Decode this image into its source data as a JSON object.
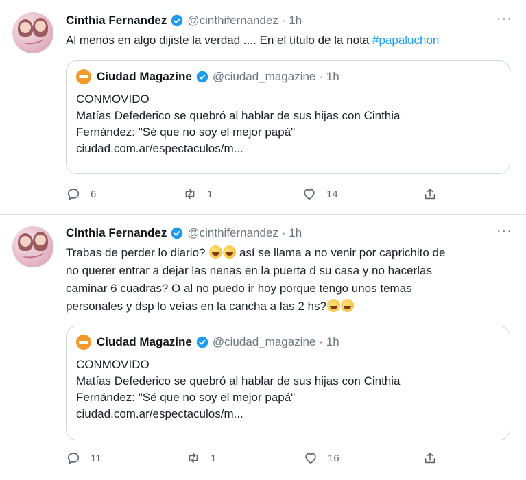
{
  "colors": {
    "link": "#1da1f2",
    "verified": "#1d9bf0",
    "muted": "#6b7780",
    "quote_logo": "#f39a2b"
  },
  "tweets": [
    {
      "author": "Cinthia Fernandez",
      "handle": "@cinthifernandez",
      "time": "· 1h",
      "more": "···",
      "text_main": "Al menos en algo dijiste la verdad .... En el título de la nota ",
      "hashtag": "#papaluchon",
      "quote": {
        "author": "Ciudad Magazine",
        "handle": "@ciudad_magazine",
        "time": "· 1h",
        "line1": "CONMOVIDO",
        "line2": "Matías Defederico se quebró al hablar de sus hijas con Cinthia",
        "line3": "Fernández: \"Sé que no soy el mejor papá\"",
        "line4": "ciudad.com.ar/espectaculos/m..."
      },
      "replies": "6",
      "retweets": "1",
      "likes": "14"
    },
    {
      "author": "Cinthia Fernandez",
      "handle": "@cinthifernandez",
      "time": "· 1h",
      "more": "···",
      "line1_a": "Trabas de perder lo diario?",
      "line1_b": "así se llama a no venir por caprichito de",
      "line2": "no querer entrar a dejar las nenas en la puerta d su casa y no hacerlas",
      "line3": "caminar 6 cuadras? O al no puedo ir hoy porque tengo unos temas",
      "line4": "personales y dsp lo veías en la cancha a las 2 hs?",
      "emoji_names": [
        "rolling-on-floor-laughing-emoji"
      ],
      "quote": {
        "author": "Ciudad Magazine",
        "handle": "@ciudad_magazine",
        "time": "· 1h",
        "line1": "CONMOVIDO",
        "line2": "Matías Defederico se quebró al hablar de sus hijas con Cinthia",
        "line3": "Fernández: \"Sé que no soy el mejor papá\"",
        "line4": "ciudad.com.ar/espectaculos/m..."
      },
      "replies": "11",
      "retweets": "1",
      "likes": "16"
    }
  ]
}
